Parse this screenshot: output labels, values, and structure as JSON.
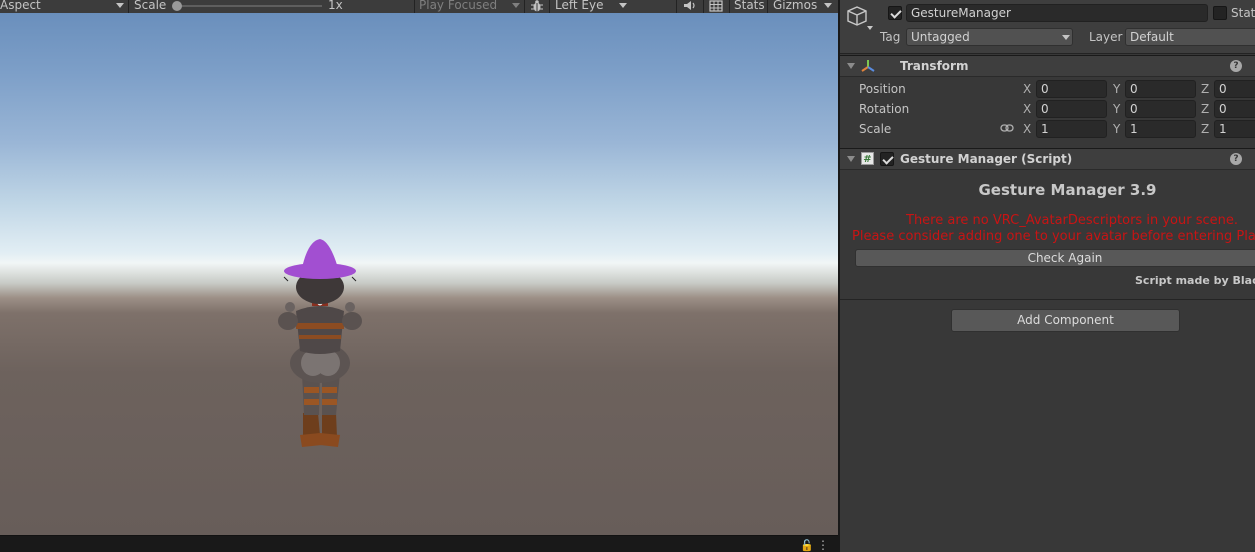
{
  "game_toolbar": {
    "aspect_label": "Aspect",
    "scale_label": "Scale",
    "scale_value": "1x",
    "play_mode": "Play Focused",
    "eye": "Left Eye",
    "stats": "Stats",
    "gizmos": "Gizmos",
    "icons": [
      "audio-icon",
      "debug-icon",
      "grid-icon"
    ]
  },
  "game_status": {
    "icons": [
      "lock-icon",
      "more-options-icon"
    ]
  },
  "inspector": {
    "object_name": "GestureManager",
    "static_label": "Static",
    "tag_label": "Tag",
    "tag_value": "Untagged",
    "layer_label": "Layer",
    "layer_value": "Default",
    "transform": {
      "title": "Transform",
      "position": {
        "label": "Position",
        "x": "0",
        "y": "0",
        "z": "0"
      },
      "rotation": {
        "label": "Rotation",
        "x": "0",
        "y": "0",
        "z": "0"
      },
      "scale": {
        "label": "Scale",
        "x": "1",
        "y": "1",
        "z": "1"
      },
      "axis_x": "X",
      "axis_y": "Y",
      "axis_z": "Z"
    },
    "script_component": {
      "title": "Gesture Manager (Script)",
      "heading": "Gesture Manager 3.9",
      "warning_line1": "There are no VRC_AvatarDescriptors in your scene.",
      "warning_line2": "Please consider adding one to your avatar before entering PlayMode.",
      "check_again": "Check Again",
      "made_by": "Script made by BlackStartx"
    },
    "add_component": "Add Component"
  },
  "colors": {
    "warning": "#c81414",
    "hat": "#a24fd1",
    "inspector_bg": "#383838",
    "toolbar_bg": "#3c3c3c"
  }
}
